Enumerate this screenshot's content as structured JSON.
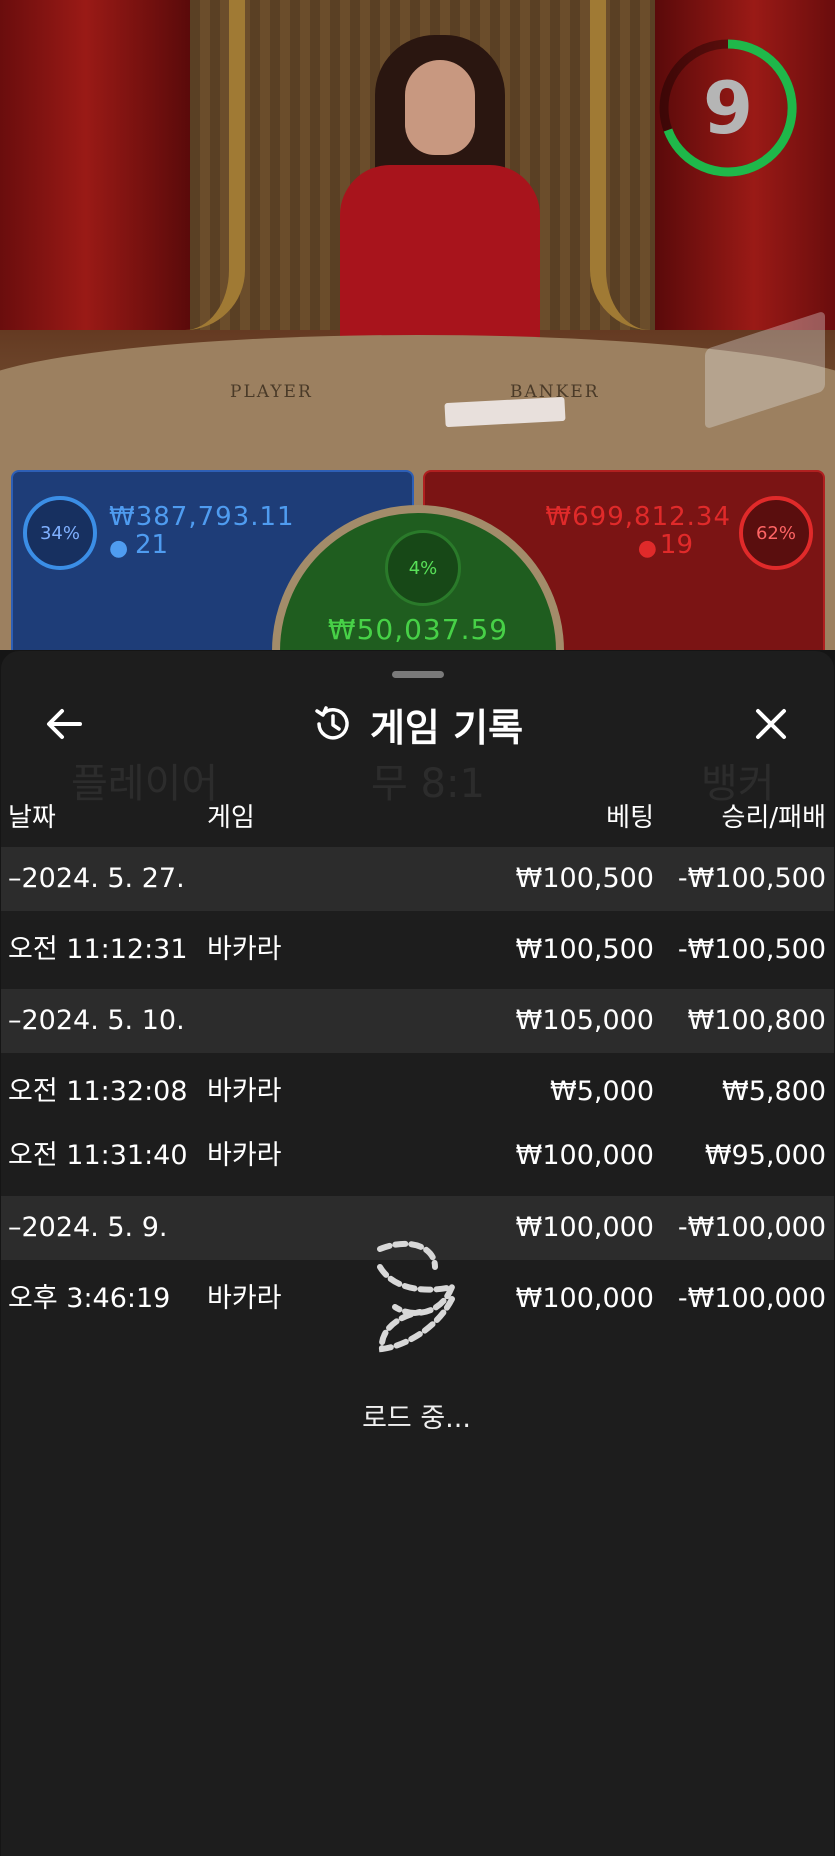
{
  "video": {
    "countdown": "9",
    "felt_player": "PLAYER",
    "felt_banker": "BANKER"
  },
  "bets": {
    "player": {
      "percent": "34%",
      "amount": "₩387,793.11",
      "count": "21",
      "color": "#3b8ee6"
    },
    "tie": {
      "percent": "4%",
      "amount": "₩50,037.59",
      "color": "#47d147"
    },
    "banker": {
      "percent": "62%",
      "amount": "₩699,812.34",
      "count": "19",
      "color": "#e02a2a"
    }
  },
  "sheet": {
    "title": "게임 기록",
    "columns": {
      "date": "날짜",
      "game": "게임",
      "bet": "베팅",
      "result": "승리/패배"
    },
    "rows": [
      {
        "type": "date",
        "date": "–2024. 5. 27.",
        "game": "",
        "bet": "₩100,500",
        "result": "-₩100,500"
      },
      {
        "type": "item",
        "date": "오전 11:12:31",
        "game": "바카라",
        "bet": "₩100,500",
        "result": "-₩100,500"
      },
      {
        "type": "date",
        "date": "–2024. 5. 10.",
        "game": "",
        "bet": "₩105,000",
        "result": "₩100,800"
      },
      {
        "type": "item",
        "date": "오전 11:32:08",
        "game": "바카라",
        "bet": "₩5,000",
        "result": "₩5,800"
      },
      {
        "type": "item",
        "date": "오전 11:31:40",
        "game": "바카라",
        "bet": "₩100,000",
        "result": "₩95,000"
      },
      {
        "type": "date",
        "date": "–2024. 5. 9.",
        "game": "",
        "bet": "₩100,000",
        "result": "-₩100,000"
      },
      {
        "type": "item",
        "date": "오후 3:46:19",
        "game": "바카라",
        "bet": "₩100,000",
        "result": "-₩100,000"
      }
    ],
    "loading": "로드 중..."
  }
}
